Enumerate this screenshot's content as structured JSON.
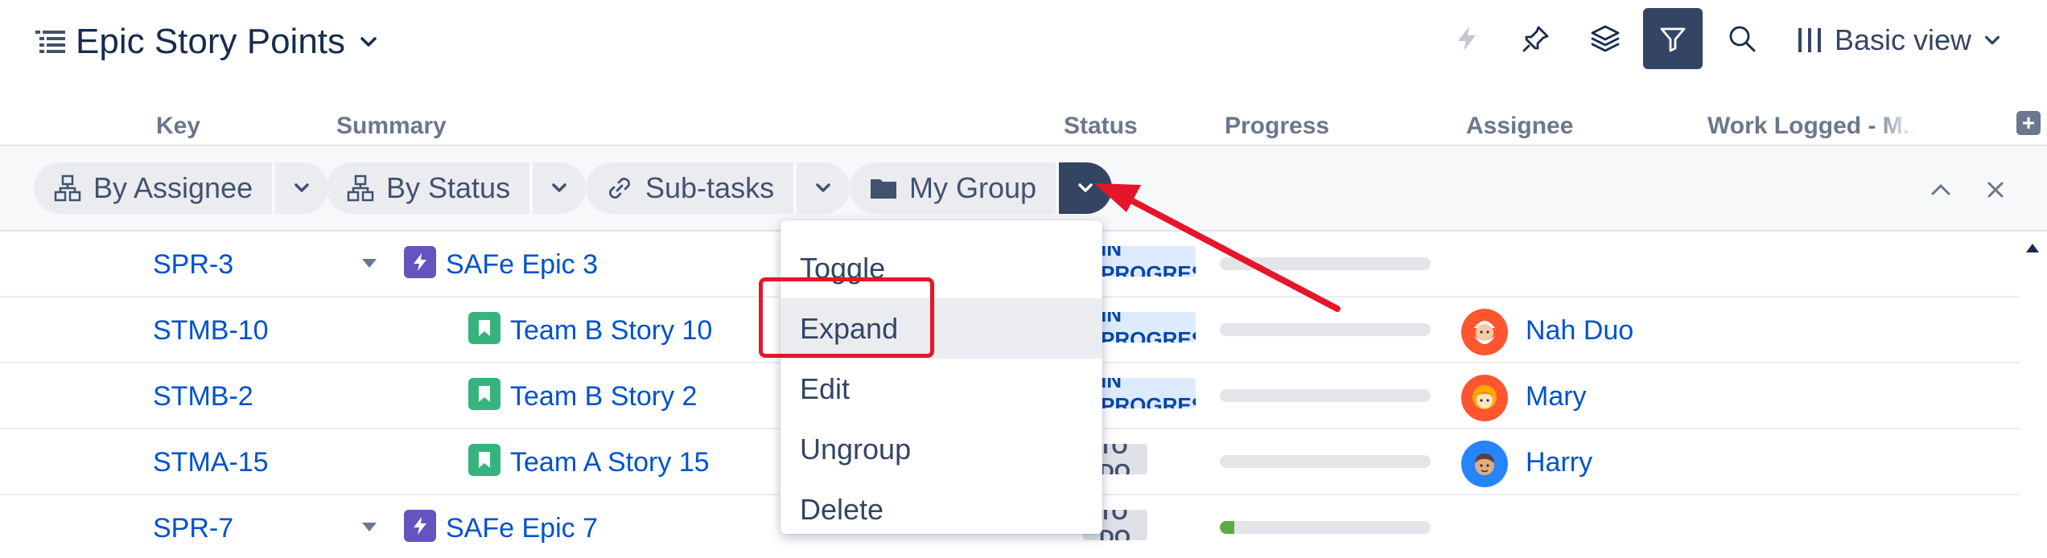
{
  "header": {
    "title": "Epic Story Points",
    "view_label": "Basic view",
    "toolbar_icons": [
      "lightning-icon",
      "pin-icon",
      "layers-icon",
      "filter-icon",
      "search-icon",
      "columns-icon"
    ]
  },
  "columns": [
    "Key",
    "Summary",
    "Status",
    "Progress",
    "Assignee",
    "Work Logged - M..."
  ],
  "grouping": [
    {
      "label": "By Assignee",
      "icon": "hierarchy-icon"
    },
    {
      "label": "By Status",
      "icon": "hierarchy-icon"
    },
    {
      "label": "Sub-tasks",
      "icon": "link-icon"
    },
    {
      "label": "My Group",
      "icon": "folder-icon"
    }
  ],
  "rows": [
    {
      "key": "SPR-3",
      "summary": "SAFe Epic 3",
      "type": "epic",
      "status": "IN PROGRESS",
      "progress": 0,
      "assignee": ""
    },
    {
      "key": "STMB-10",
      "summary": "Team B Story 10",
      "type": "story",
      "status": "IN PROGRESS",
      "progress": 0,
      "assignee": "Nah Duo"
    },
    {
      "key": "STMB-2",
      "summary": "Team B Story 2",
      "type": "story",
      "status": "IN PROGRESS",
      "progress": 0,
      "assignee": "Mary"
    },
    {
      "key": "STMA-15",
      "summary": "Team A Story 15",
      "type": "story",
      "status": "TO DO",
      "progress": 0,
      "assignee": "Harry"
    },
    {
      "key": "SPR-7",
      "summary": "SAFe Epic 7",
      "type": "epic",
      "status": "TO DO",
      "progress": 0.07,
      "assignee": ""
    }
  ],
  "menu": {
    "items": [
      "Toggle",
      "Expand",
      "Edit",
      "Ungroup",
      "Delete"
    ],
    "highlighted": "Expand"
  },
  "colors": {
    "accent_dark": "#344563",
    "link": "#0052cc",
    "annotation_red": "#e5162a",
    "epic_purple": "#6554c0",
    "story_green": "#36b37e",
    "progress_green": "#5aac44"
  }
}
